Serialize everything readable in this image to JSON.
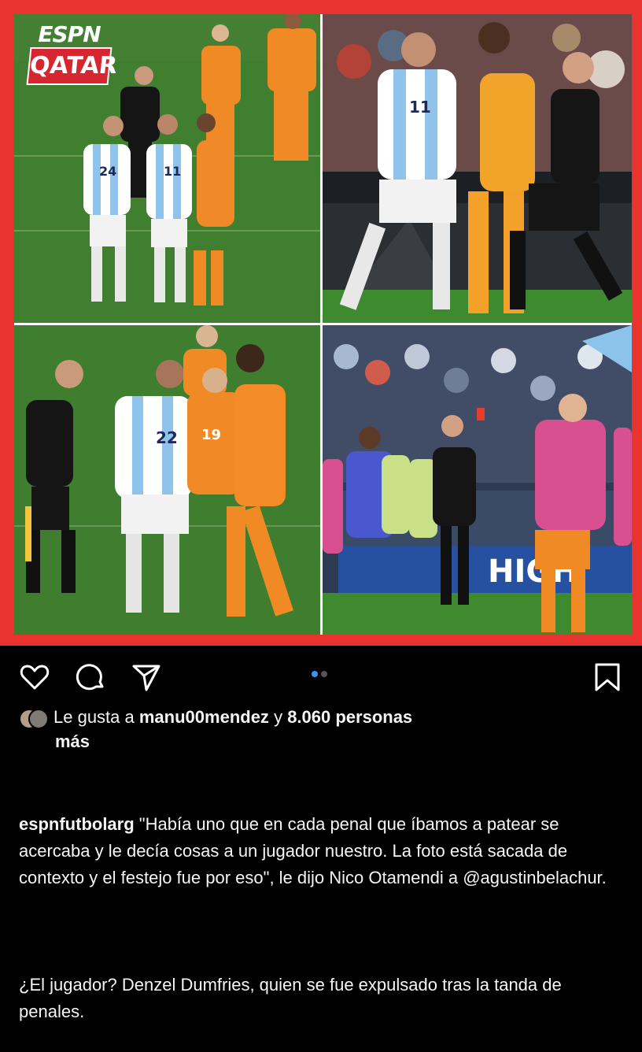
{
  "post_image": {
    "badge_top": "ESPN",
    "badge_bottom": "QATAR",
    "photos": [
      {
        "jersey_numbers": [
          "24",
          "11"
        ]
      },
      {
        "jersey_numbers": [
          "11"
        ]
      },
      {
        "jersey_numbers": [
          "22",
          "19"
        ]
      },
      {
        "banner_text": "HIGH"
      }
    ],
    "border_color": "#e8332f"
  },
  "actions": {
    "icons": [
      "heart-icon",
      "comment-icon",
      "share-icon",
      "bookmark-icon"
    ],
    "carousel_dots": 2,
    "active_dot": 0,
    "accent": "#3897f0"
  },
  "likes": {
    "prefix": "Le gusta a",
    "user": "manu00mendez",
    "connector": "y",
    "count": "8.060 personas",
    "suffix": "más"
  },
  "caption": {
    "username": "espnfutbolarg",
    "text_1": " \"Había uno que en cada penal que íbamos a patear se acercaba y le decía cosas a un jugador nuestro. La foto está sacada de contexto y el festejo fue por eso\", le dijo Nico Otamendi a @agustinbelachur.",
    "text_2": "¿El jugador? Denzel Dumfries, quien se fue expulsado tras la tanda de penales."
  }
}
